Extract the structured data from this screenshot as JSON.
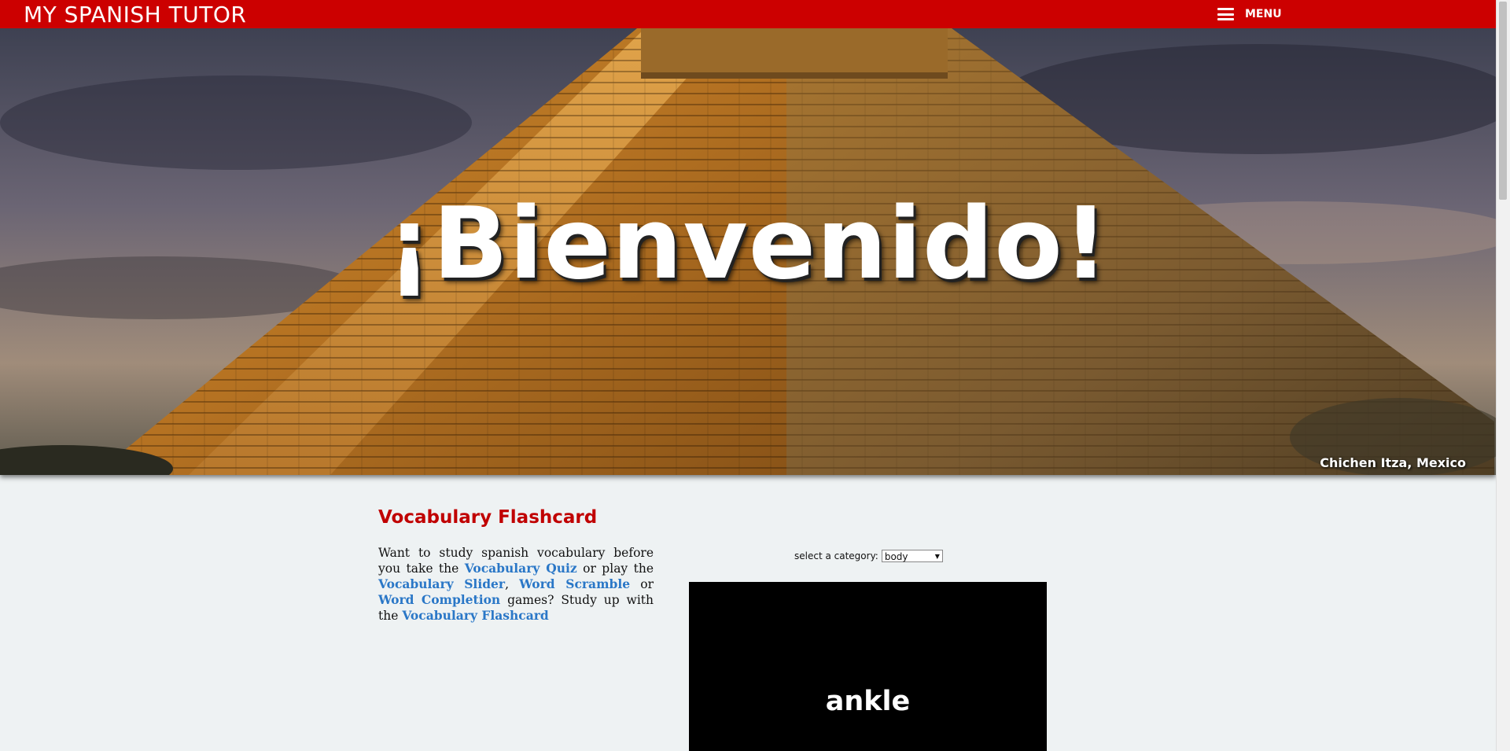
{
  "header": {
    "brand": "MY SPANISH TUTOR",
    "menu_label": "MENU",
    "menu_icon": "hamburger-icon",
    "bar_color": "#cc0000"
  },
  "hero": {
    "title": "¡Bienvenido!",
    "caption": "Chichen Itza, Mexico"
  },
  "content": {
    "section_title": "Vocabulary Flashcard",
    "intro": {
      "t1": "Want to study spanish vocabulary before you take the",
      "link_quiz": "Vocabulary Quiz",
      "t2": "or play the",
      "link_slider": "Vocabulary Slider",
      "t3": ",",
      "link_scramble": "Word Scramble",
      "t4": "or",
      "link_completion": "Word Completion",
      "t5": "games? Study up with the",
      "link_flashcard": "Vocabulary Flashcard"
    },
    "category": {
      "label": "select a category:",
      "selected": "body"
    },
    "flashcard": {
      "word": "ankle"
    }
  },
  "colors": {
    "accent": "#cc0000",
    "link": "#2a77c7",
    "page_bg": "#eef2f3"
  }
}
